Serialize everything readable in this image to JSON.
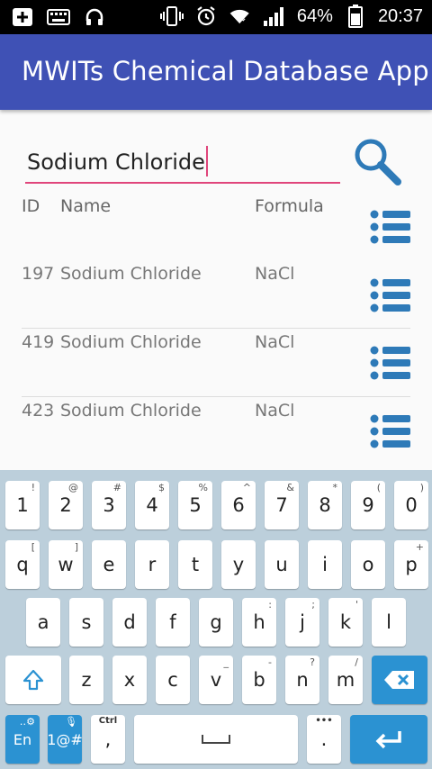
{
  "status_bar": {
    "battery": "64%",
    "time": "20:37",
    "left_icons": [
      "add-box-icon",
      "keyboard-icon",
      "headset-icon"
    ],
    "right_icons": [
      "vibrate-icon",
      "alarm-icon",
      "wifi-icon",
      "signal-icon",
      "battery-icon"
    ]
  },
  "app_bar": {
    "title": "MWITs Chemical Database App"
  },
  "search": {
    "value": "Sodium Chloride",
    "icon": "search-icon"
  },
  "table": {
    "headers": {
      "id": "ID",
      "name": "Name",
      "formula": "Formula"
    },
    "rows": [
      {
        "id": "197",
        "name": "Sodium Chloride",
        "formula": "NaCl"
      },
      {
        "id": "419",
        "name": "Sodium Chloride",
        "formula": "NaCl"
      },
      {
        "id": "423",
        "name": "Sodium Chloride",
        "formula": "NaCl"
      }
    ],
    "row_icon": "list-icon"
  },
  "keyboard": {
    "row1": [
      {
        "k": "1",
        "s": "!"
      },
      {
        "k": "2",
        "s": "@"
      },
      {
        "k": "3",
        "s": "#"
      },
      {
        "k": "4",
        "s": "$"
      },
      {
        "k": "5",
        "s": "%"
      },
      {
        "k": "6",
        "s": "^"
      },
      {
        "k": "7",
        "s": "&"
      },
      {
        "k": "8",
        "s": "*"
      },
      {
        "k": "9",
        "s": "("
      },
      {
        "k": "0",
        "s": ")"
      }
    ],
    "row2": [
      {
        "k": "q",
        "s": "["
      },
      {
        "k": "w",
        "s": "]"
      },
      {
        "k": "e",
        "s": ""
      },
      {
        "k": "r",
        "s": ""
      },
      {
        "k": "t",
        "s": ""
      },
      {
        "k": "y",
        "s": ""
      },
      {
        "k": "u",
        "s": ""
      },
      {
        "k": "i",
        "s": ""
      },
      {
        "k": "o",
        "s": ""
      },
      {
        "k": "p",
        "s": "+"
      }
    ],
    "row3": [
      {
        "k": "a",
        "s": ""
      },
      {
        "k": "s",
        "s": ""
      },
      {
        "k": "d",
        "s": ""
      },
      {
        "k": "f",
        "s": ""
      },
      {
        "k": "g",
        "s": ""
      },
      {
        "k": "h",
        "s": ":"
      },
      {
        "k": "j",
        "s": ";"
      },
      {
        "k": "k",
        "s": "'"
      },
      {
        "k": "l",
        "s": ""
      }
    ],
    "row4": [
      {
        "k": "z",
        "s": ""
      },
      {
        "k": "x",
        "s": ""
      },
      {
        "k": "c",
        "s": ""
      },
      {
        "k": "v",
        "s": "_"
      },
      {
        "k": "b",
        "s": "-"
      },
      {
        "k": "n",
        "s": "?"
      },
      {
        "k": "m",
        "s": "/"
      }
    ],
    "lang": "En",
    "symbols": "1@#",
    "comma": ",",
    "comma_sup": "Ctrl",
    "period": ".",
    "period_sup": "•••",
    "colors": {
      "accent_blue": "#2b92d2",
      "appbar": "#3f51b5",
      "underline": "#e0457b"
    }
  }
}
